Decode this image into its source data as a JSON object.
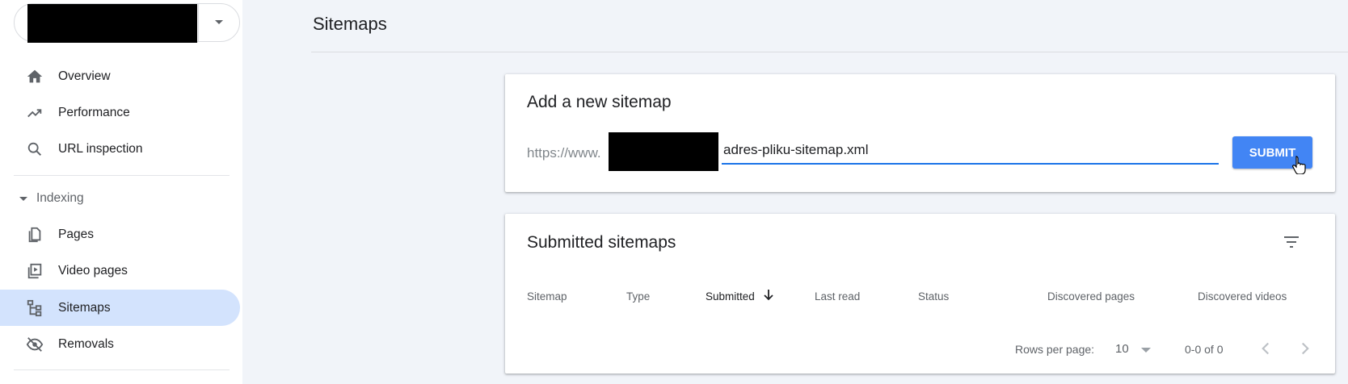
{
  "sidebar": {
    "items": [
      {
        "label": "Overview",
        "icon": "home-icon"
      },
      {
        "label": "Performance",
        "icon": "trending-up-icon"
      },
      {
        "label": "URL inspection",
        "icon": "search-icon"
      }
    ],
    "section": {
      "label": "Indexing",
      "icon": "caret-down-icon"
    },
    "indexing_items": [
      {
        "label": "Pages",
        "icon": "pages-icon"
      },
      {
        "label": "Video pages",
        "icon": "video-pages-icon"
      },
      {
        "label": "Sitemaps",
        "icon": "sitemap-icon",
        "active": true
      },
      {
        "label": "Removals",
        "icon": "eye-off-icon"
      }
    ]
  },
  "header": {
    "title": "Sitemaps"
  },
  "add_sitemap": {
    "title": "Add a new sitemap",
    "url_prefix": "https://www.",
    "input_value": "adres-pliku-sitemap.xml",
    "submit_label": "SUBMIT"
  },
  "submitted": {
    "title": "Submitted sitemaps",
    "columns": [
      "Sitemap",
      "Type",
      "Submitted",
      "Last read",
      "Status",
      "Discovered pages",
      "Discovered videos"
    ],
    "sorted_column": "Submitted",
    "rows_per_page_label": "Rows per page:",
    "rows_per_page_value": "10",
    "range_text": "0-0 of 0"
  },
  "colors": {
    "accent": "#4285f4",
    "active_nav": "#d3e3fd",
    "input_underline": "#1a73e8",
    "background": "#f1f4f9"
  }
}
